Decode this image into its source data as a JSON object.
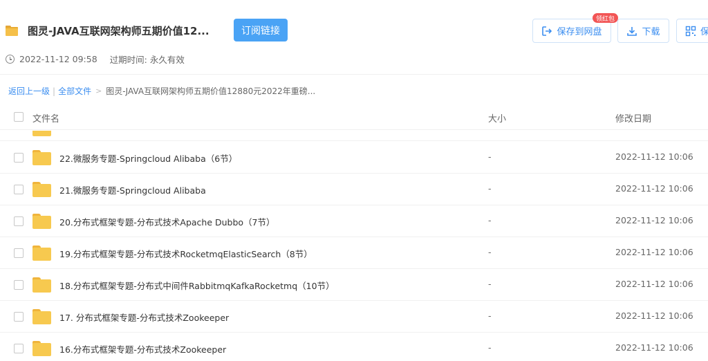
{
  "header": {
    "title": "图灵-JAVA互联网架构师五期价值12...",
    "subscribe_label": "订阅链接",
    "created_time": "2022-11-12 09:58",
    "expire_label": "过期时间:",
    "expire_value": "永久有效",
    "save_to_drive_label": "保存到网盘",
    "redpack_badge": "领红包",
    "download_label": "下载",
    "save2_label": "保",
    "accent_color": "#3b8ef0"
  },
  "breadcrumb": {
    "back_label": "返回上一级",
    "all_files_label": "全部文件",
    "current": "图灵-JAVA互联网架构师五期价值12880元2022年重磅..."
  },
  "table": {
    "columns": {
      "name": "文件名",
      "size": "大小",
      "date": "修改日期"
    },
    "rows": [
      {
        "name": "22.微服务专题-Springcloud Alibaba（6节）",
        "size": "-",
        "date": "2022-11-12 10:06"
      },
      {
        "name": "21.微服务专题-Springcloud Alibaba",
        "size": "-",
        "date": "2022-11-12 10:06"
      },
      {
        "name": "20.分布式框架专题-分布式技术Apache Dubbo（7节）",
        "size": "-",
        "date": "2022-11-12 10:06"
      },
      {
        "name": "19.分布式框架专题-分布式技术RocketmqElasticSearch（8节）",
        "size": "-",
        "date": "2022-11-12 10:06"
      },
      {
        "name": "18.分布式框架专题-分布式中间件RabbitmqKafkaRocketmq（10节）",
        "size": "-",
        "date": "2022-11-12 10:06"
      },
      {
        "name": "17. 分布式框架专题-分布式技术Zookeeper",
        "size": "-",
        "date": "2022-11-12 10:06"
      },
      {
        "name": "16.分布式框架专题-分布式技术Zookeeper",
        "size": "-",
        "date": "2022-11-12 10:06"
      }
    ]
  }
}
